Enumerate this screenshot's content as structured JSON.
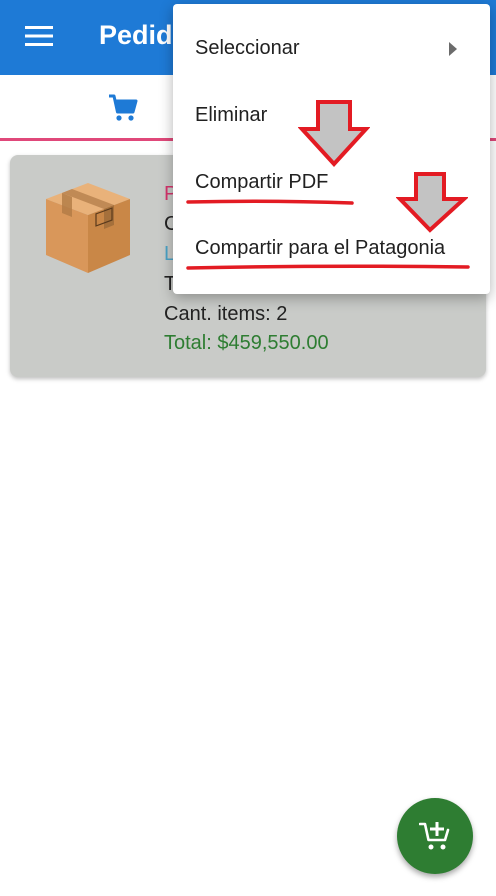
{
  "appbar": {
    "title": "Pedid",
    "menu_icon": "hamburger-menu-icon",
    "color": "#1e7ad6"
  },
  "tabs": {
    "cart_icon": "shopping-cart-icon",
    "indicator_color": "#e0487a"
  },
  "order": {
    "line1": "P",
    "line2": "C",
    "line3": "L",
    "line4": "T",
    "items_count": "Cant. items: 2",
    "total": "Total: $459,550.00",
    "image_icon": "package-box-icon"
  },
  "popup_menu": {
    "items": [
      {
        "label": "Seleccionar",
        "has_submenu": true
      },
      {
        "label": "Eliminar"
      },
      {
        "label": "Compartir PDF"
      },
      {
        "label": "Compartir para el Patagonia"
      }
    ]
  },
  "annotations": {
    "color": "#e31b23",
    "arrow_fill": "#c3c3c3"
  },
  "fab": {
    "icon": "add-to-cart-icon",
    "color": "#2e7d32"
  }
}
